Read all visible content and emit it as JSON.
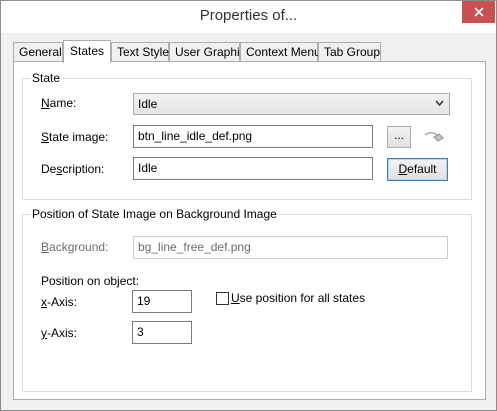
{
  "window": {
    "title": "Properties of..."
  },
  "tabs": [
    {
      "label": "General"
    },
    {
      "label": "States"
    },
    {
      "label": "Text Style"
    },
    {
      "label": "User Graphic"
    },
    {
      "label": "Context Menu"
    },
    {
      "label": "Tab Group"
    }
  ],
  "state_group": {
    "title": "State",
    "name_label_key": "N",
    "name_label_rest": "ame:",
    "name_value": "Idle",
    "image_label_key": "S",
    "image_label_rest": "tate image:",
    "image_value": "btn_line_idle_def.png",
    "browse_label": "...",
    "description_label_pre": "De",
    "description_label_key": "s",
    "description_label_rest": "cription:",
    "description_value": "Idle",
    "default_label_key": "D",
    "default_label_rest": "efault"
  },
  "position_group": {
    "title": "Position of State Image on Background Image",
    "background_label_key": "B",
    "background_label_rest": "ackground:",
    "background_value": "bg_line_free_def.png",
    "position_on_object": "Position on object:",
    "x_label_key": "x",
    "x_label_rest": "-Axis:",
    "x_value": "19",
    "y_label_key": "y",
    "y_label_rest": "-Axis:",
    "y_value": "3",
    "use_all_key": "U",
    "use_all_rest": "se position for all states",
    "use_all_checked": false
  }
}
